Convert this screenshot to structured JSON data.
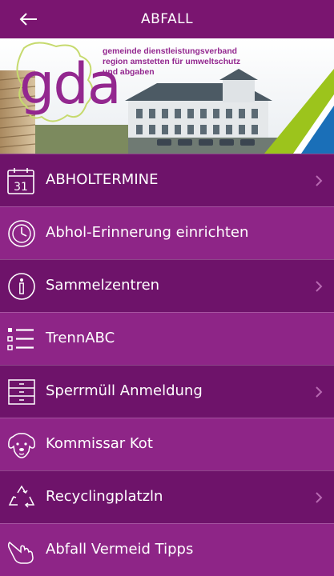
{
  "header": {
    "title": "ABFALL",
    "back_icon": "arrow-left-icon"
  },
  "banner": {
    "logo_text": "gda",
    "org_line1": "gemeinde dienstleistungsverband",
    "org_line2": "region amstetten für umweltschutz",
    "org_line3": "und abgaben"
  },
  "menu": {
    "items": [
      {
        "label": "ABHOLTERMINE",
        "icon": "calendar-icon",
        "calendar_day": "31",
        "chevron": true
      },
      {
        "label": "Abhol-Erinnerung einrichten",
        "icon": "clock-icon",
        "chevron": false
      },
      {
        "label": "Sammelzentren",
        "icon": "info-icon",
        "chevron": true
      },
      {
        "label": "TrennABC",
        "icon": "list-icon",
        "chevron": false
      },
      {
        "label": "Sperrmüll Anmeldung",
        "icon": "drawers-icon",
        "chevron": true
      },
      {
        "label": "Kommissar Kot",
        "icon": "dog-icon",
        "chevron": false
      },
      {
        "label": "Recyclingplatzln",
        "icon": "recycle-icon",
        "chevron": true
      },
      {
        "label": "Abfall Vermeid Tipps",
        "icon": "hand-pointer-icon",
        "chevron": false
      }
    ]
  },
  "colors": {
    "topbar": "#7a1570",
    "row_dark": "#6e136a",
    "row_light": "#8e2587",
    "brand_purple": "#93278f",
    "accent_green": "#9cc41c",
    "accent_blue": "#1a6fb8"
  }
}
